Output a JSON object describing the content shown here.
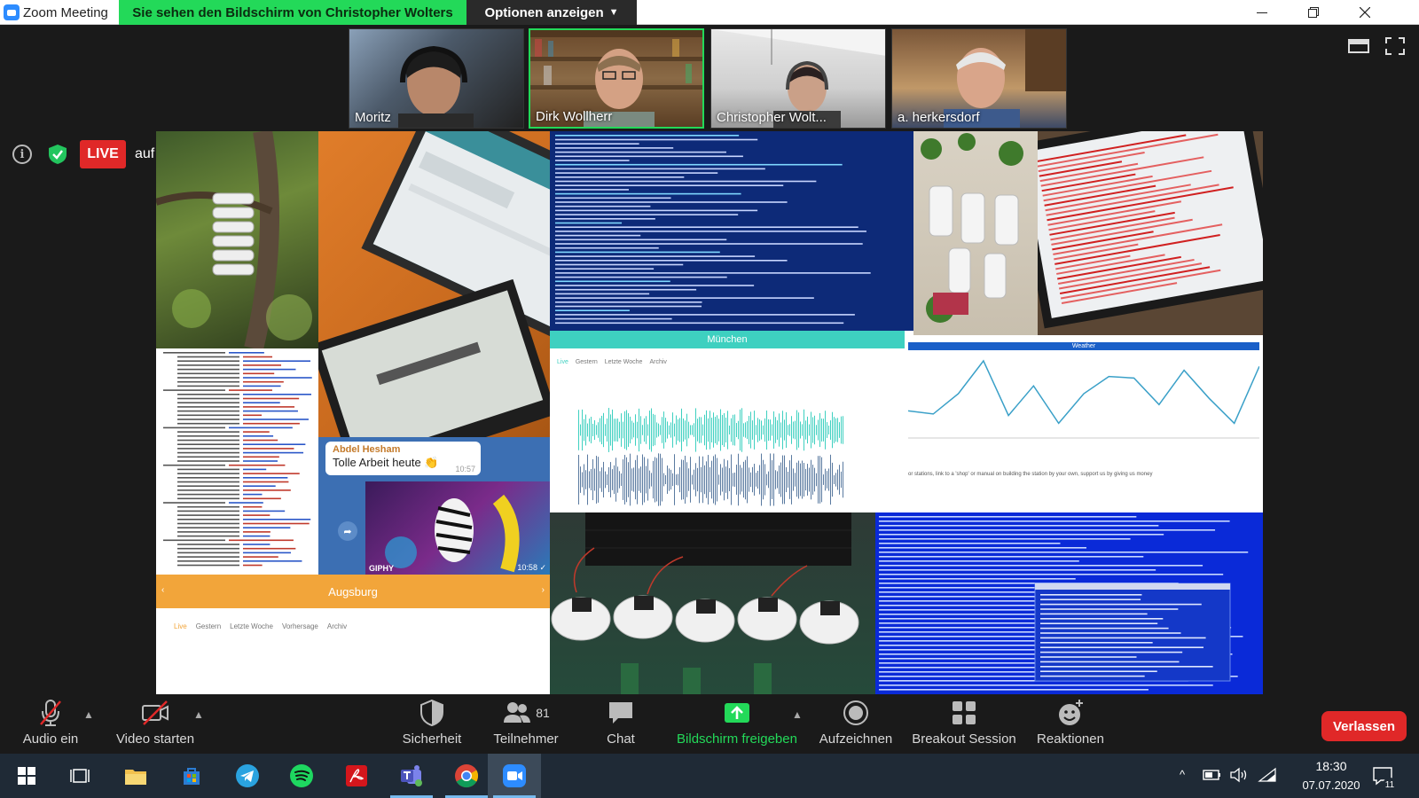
{
  "window": {
    "title": "Zoom Meeting"
  },
  "share_banner": {
    "text": "Sie sehen den Bildschirm von Christopher Wolters"
  },
  "options_button": {
    "label": "Optionen anzeigen"
  },
  "participants": [
    {
      "name": "Moritz"
    },
    {
      "name": "Dirk Wollherr"
    },
    {
      "name": "Christopher Wolt..."
    },
    {
      "name": "a. herkersdorf"
    }
  ],
  "live": {
    "badge": "LIVE",
    "target": "auf YouTube"
  },
  "shared_screen": {
    "chat_sender": "Abdel Hesham",
    "chat_message": "Tolle Arbeit heute 👏",
    "chat_time": "10:57",
    "gif_label": "GIPHY",
    "gif_time": "10:58 ✓",
    "city_munich": "München",
    "city_augsburg": "Augsburg",
    "tabs_munich": [
      "Live",
      "Gestern",
      "Letzte Woche",
      "Archiv"
    ],
    "tabs_augsburg": [
      "Live",
      "Gestern",
      "Letzte Woche",
      "Vorhersage",
      "Archiv"
    ],
    "weather_header": "Weather",
    "weather_footer": "or stations, link to a 'shop' or manual on building the station by your own, support us by giving us money",
    "weather_series": [
      0.28,
      0.24,
      0.5,
      0.92,
      0.22,
      0.6,
      0.12,
      0.5,
      0.72,
      0.7,
      0.36,
      0.8,
      0.44,
      0.12,
      0.85
    ]
  },
  "toolbar": {
    "audio": "Audio ein",
    "video": "Video starten",
    "security": "Sicherheit",
    "participants": "Teilnehmer",
    "participants_count": "81",
    "chat": "Chat",
    "share": "Bildschirm freigeben",
    "record": "Aufzeichnen",
    "breakout": "Breakout Session",
    "reactions": "Reaktionen",
    "leave": "Verlassen"
  },
  "taskbar": {
    "time": "18:30",
    "date": "07.07.2020",
    "notification_count": "11"
  },
  "colors": {
    "share_green": "#23d959",
    "leave_red": "#e02828",
    "zoom_blue": "#2d8cff"
  }
}
